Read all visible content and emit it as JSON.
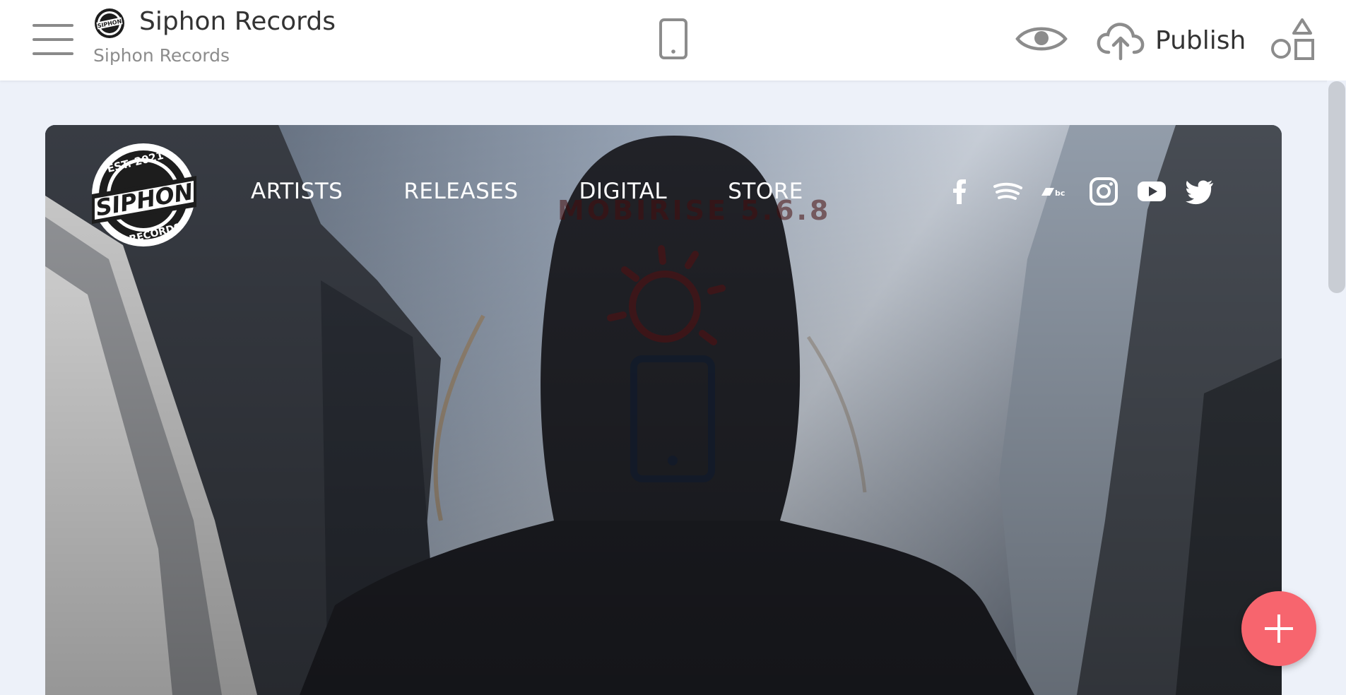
{
  "editor": {
    "site_title": "Siphon Records",
    "site_subtitle": "Siphon Records",
    "publish_label": "Publish",
    "icons": {
      "menu": "hamburger-menu-icon",
      "device": "mobile-phone-icon",
      "preview": "eye-icon",
      "publish": "cloud-upload-icon",
      "blocks": "blocks-shapes-icon",
      "add": "plus-icon"
    }
  },
  "site": {
    "logo_lines": [
      "EST. 2021",
      "SIPHON",
      "RECORDS"
    ],
    "nav": [
      "ARTISTS",
      "RELEASES",
      "DIGITAL",
      "STORE"
    ],
    "social": [
      "facebook-icon",
      "spotify-icon",
      "bandcamp-icon",
      "instagram-icon",
      "youtube-icon",
      "twitter-icon"
    ]
  },
  "loader": {
    "text": "MOBIRISE 5.6.8"
  },
  "colors": {
    "accent": "#f7656e",
    "canvas_bg": "#edf1f9",
    "text_dark": "#333333",
    "text_muted": "#8c8c8c"
  }
}
